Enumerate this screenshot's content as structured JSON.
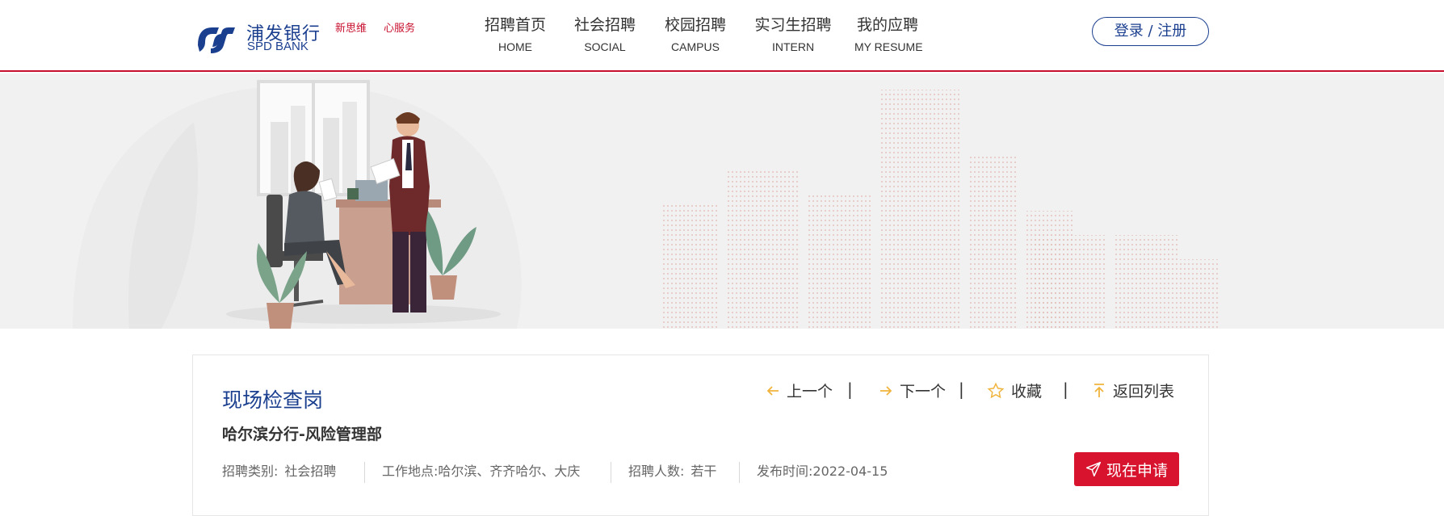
{
  "brand": {
    "name_cn": "浦发银行",
    "name_en": "SPD BANK",
    "slogan_1": "新思维",
    "slogan_2": "心服务",
    "color_primary": "#1b3f8f",
    "color_accent": "#c8102e"
  },
  "nav": [
    {
      "cn": "招聘首页",
      "en": "HOME"
    },
    {
      "cn": "社会招聘",
      "en": "SOCIAL"
    },
    {
      "cn": "校园招聘",
      "en": "CAMPUS"
    },
    {
      "cn": "实习生招聘",
      "en": "INTERN"
    },
    {
      "cn": "我的应聘",
      "en": "MY RESUME"
    }
  ],
  "login_label": "登录 / 注册",
  "job": {
    "title": "现场检查岗",
    "department": "哈尔滨分行-风险管理部",
    "actions": {
      "prev": "上一个",
      "next": "下一个",
      "favorite": "收藏",
      "back": "返回列表",
      "separator": "|"
    },
    "meta": {
      "category_label": "招聘类别:",
      "category_value": "社会招聘",
      "location_label": "工作地点:",
      "location_value": "哈尔滨、齐齐哈尔、大庆",
      "count_label": "招聘人数:",
      "count_value": "若干",
      "date_label": "发布时间:",
      "date_value": "2022-04-15"
    },
    "apply_label": "现在申请"
  },
  "icons": {
    "prev": "arrow-left-icon",
    "next": "arrow-right-icon",
    "favorite": "star-icon",
    "back": "arrow-up-icon",
    "apply": "paper-plane-icon"
  }
}
